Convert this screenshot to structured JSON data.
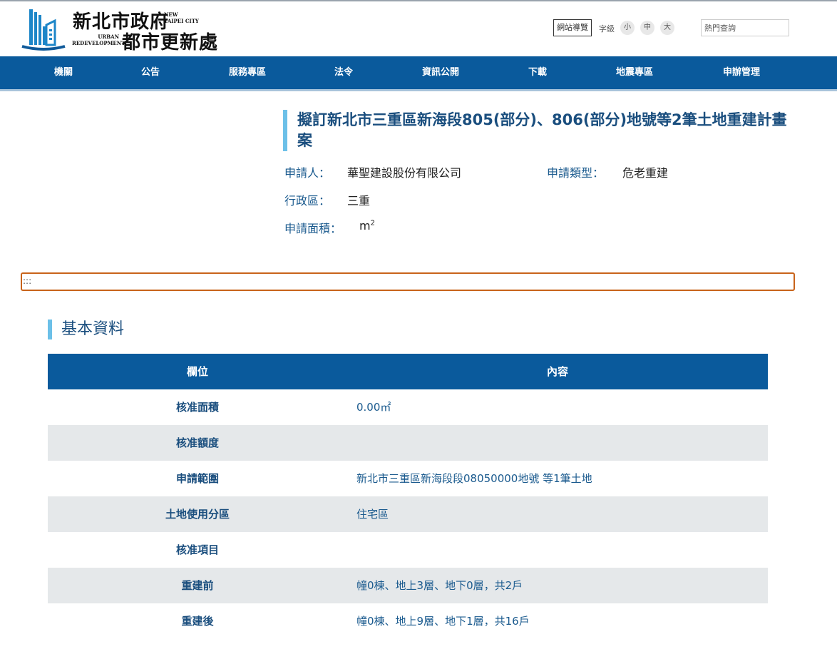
{
  "header": {
    "logo_cn_line1": "新北市政府",
    "logo_en_line1a": "NEW",
    "logo_en_line1b": "TAIPEI CITY",
    "logo_en_line2a": "URBAN",
    "logo_en_line2b": "REDEVELOPMENT",
    "logo_cn_line2": "都市更新處",
    "sitemap_label": "網站導覽",
    "fontsize_label": "字級",
    "fontsize_options": [
      "小",
      "中",
      "大"
    ],
    "search_placeholder": "熱門查詢"
  },
  "nav": {
    "items": [
      "機關",
      "公告",
      "服務專區",
      "法令",
      "資訊公開",
      "下載",
      "地震專區",
      "申辦管理"
    ]
  },
  "case": {
    "title": "擬訂新北市三重區新海段805(部分)、806(部分)地號等2筆土地重建計畫案",
    "applicant_label": "申請人：",
    "applicant_value": "華聖建設股份有限公司",
    "type_label": "申請類型：",
    "type_value": "危老重建",
    "district_label": "行政區：",
    "district_value": "三重",
    "area_label": "申請面積：",
    "area_unit": "m",
    "area_unit_sup": "2"
  },
  "focus_bar": {
    "text": ":::"
  },
  "section": {
    "title": "基本資料",
    "col_field": "欄位",
    "col_content": "內容",
    "rows": [
      {
        "field": "核准面積",
        "value": "0.00㎡"
      },
      {
        "field": "核准額度",
        "value": ""
      },
      {
        "field": "申請範圍",
        "value": "新北市三重區新海段段08050000地號 等1筆土地"
      },
      {
        "field": "土地使用分區",
        "value": "住宅區"
      },
      {
        "field": "核准項目",
        "value": ""
      },
      {
        "field": "重建前",
        "value": "幢0棟、地上3層、地下0層，共2戶"
      },
      {
        "field": "重建後",
        "value": "幢0棟、地上9層、地下1層，共16戶"
      }
    ]
  },
  "colors": {
    "nav_bg": "#0a5a9c",
    "accent_bar": "#6cc0e8",
    "title_text": "#1a4e7e",
    "focus_outline": "#c8631a",
    "row_alt": "#e5e8ea"
  }
}
